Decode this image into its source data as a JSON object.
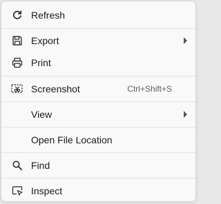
{
  "menu": {
    "items": [
      {
        "label": "Refresh",
        "icon": "refresh-icon"
      },
      {
        "label": "Export",
        "icon": "save-icon",
        "submenu": true
      },
      {
        "label": "Print",
        "icon": "printer-icon"
      },
      {
        "label": "Screenshot",
        "icon": "screenshot-icon",
        "shortcut": "Ctrl+Shift+S"
      },
      {
        "label": "View",
        "submenu": true
      },
      {
        "label": "Open File Location"
      },
      {
        "label": "Find",
        "icon": "search-icon"
      },
      {
        "label": "Inspect",
        "icon": "inspect-icon"
      }
    ]
  },
  "colors": {
    "background": "#f9f9f9",
    "text": "#1a1a1a",
    "shortcut_text": "#5d5d5d",
    "separator": "#e3e3e3"
  }
}
